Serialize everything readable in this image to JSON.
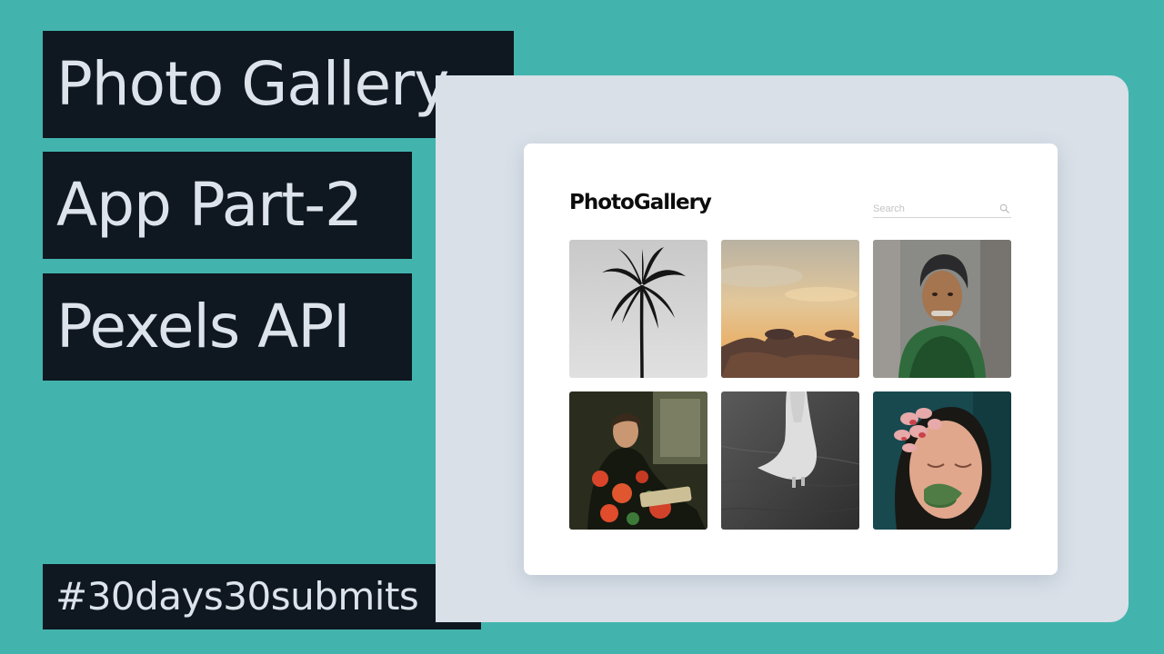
{
  "title_lines": [
    "Photo Gallery",
    "App Part-2",
    "Pexels API"
  ],
  "hashtag": "#30days30submits",
  "app": {
    "logo": "PhotoGallery",
    "search": {
      "placeholder": "Search",
      "value": "",
      "icon": "search-icon"
    },
    "photos": [
      {
        "subject": "palm tree silhouette on grey sky"
      },
      {
        "subject": "sunset clouds"
      },
      {
        "subject": "man wearing turban and green scarf"
      },
      {
        "subject": "woman in floral dress reading a book"
      },
      {
        "subject": "woman in white dress walking in grass"
      },
      {
        "subject": "woman with flower petals on face"
      }
    ]
  },
  "colors": {
    "background": "#42b4ad",
    "banner": "#0f1720",
    "banner_text": "#dde3ea",
    "backdrop": "#d9e0e8",
    "card": "#ffffff"
  }
}
